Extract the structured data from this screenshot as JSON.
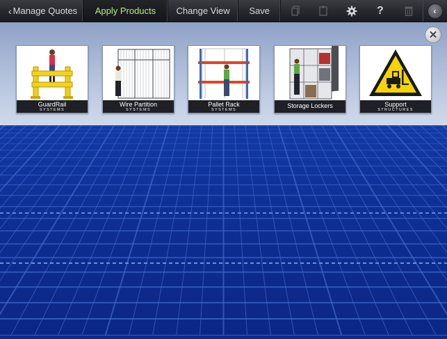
{
  "toolbar": {
    "back_label": "Manage Quotes",
    "apply_label": "Apply Products",
    "view_label": "Change View",
    "save_label": "Save",
    "settings_icon": "gear-icon",
    "help_icon": "?"
  },
  "tray": {
    "close_glyph": "✕",
    "products": [
      {
        "name": "GuardRail",
        "sub": "SYSTEMS"
      },
      {
        "name": "Wire Partition",
        "sub": "SYSTEMS"
      },
      {
        "name": "Pallet Rack",
        "sub": "SYSTEMS"
      },
      {
        "name": "Storage Lockers",
        "sub": ""
      },
      {
        "name": "Support",
        "sub": "STRUCTURES"
      }
    ]
  },
  "colors": {
    "floor": "#0d2a8c",
    "grid": "#3f68c8",
    "guardrail": "#f4d31a",
    "rack": "#e2451e",
    "warning": "#f6d400"
  }
}
